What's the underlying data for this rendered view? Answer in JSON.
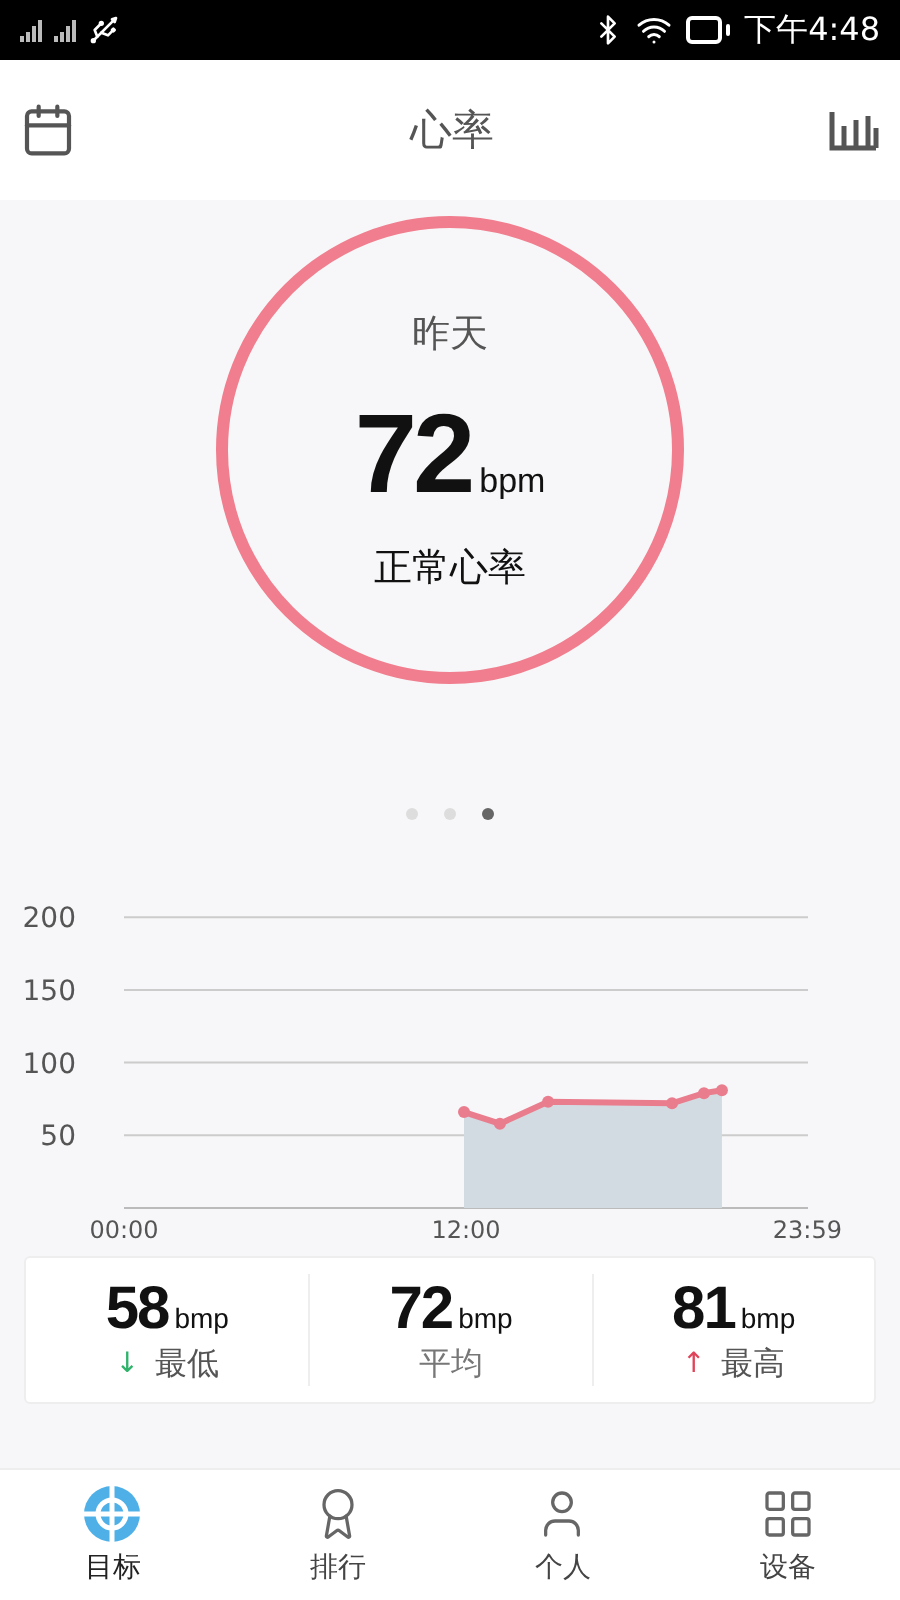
{
  "status_bar": {
    "time": "下午4:48"
  },
  "header": {
    "title": "心率"
  },
  "summary": {
    "day": "昨天",
    "value": "72",
    "unit": "bpm",
    "status": "正常心率"
  },
  "pager": [
    {
      "selected": false
    },
    {
      "selected": false
    },
    {
      "selected": true
    }
  ],
  "chart": {
    "chart_data": {
      "type": "line",
      "grid": true,
      "xlim": [
        0,
        24
      ],
      "ylim": [
        0,
        200
      ],
      "yticks": [
        50,
        100,
        150,
        200
      ],
      "xticks": [
        {
          "value": 0,
          "label": "00:00"
        },
        {
          "value": 12,
          "label": "12:00"
        },
        {
          "value": 23.98,
          "label": "23:59"
        }
      ],
      "x": [
        11.93,
        13.19,
        14.88,
        19.23,
        20.35,
        20.98
      ],
      "series": [
        {
          "color": "#e97d8e",
          "marker": "circle",
          "values": [
            66,
            58,
            73,
            72,
            79,
            81
          ]
        }
      ]
    }
  },
  "stats": [
    {
      "kind": "low",
      "value": "58",
      "unit": "bmp",
      "arrow": "↓",
      "label": "最低"
    },
    {
      "kind": "avg",
      "value": "72",
      "unit": "bmp",
      "label": "平均"
    },
    {
      "kind": "high",
      "value": "81",
      "unit": "bmp",
      "arrow": "↑",
      "label": "最高"
    }
  ],
  "tabs": [
    {
      "label": "目标",
      "selected": true
    },
    {
      "label": "排行",
      "selected": false
    },
    {
      "label": "个人",
      "selected": false
    },
    {
      "label": "设备",
      "selected": false
    }
  ]
}
